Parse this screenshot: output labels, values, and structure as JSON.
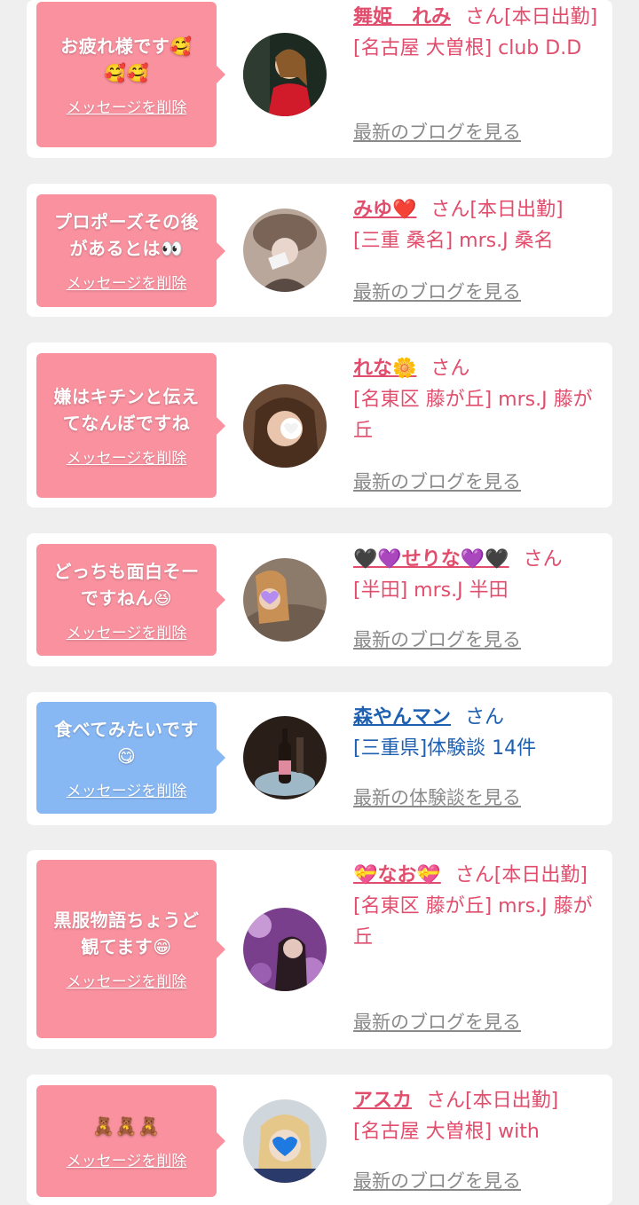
{
  "cards": [
    {
      "message_line1": "お疲れ様です🥰",
      "message_line2": "🥰🥰",
      "delete_label": "メッセージを削除",
      "name": "舞姫　れみ",
      "honorific": "さん[本日出勤]",
      "shop": "[名古屋 大曽根] club D.D",
      "link": "最新のブログを見る"
    },
    {
      "message_line1": "プロポーズその後",
      "message_line2": "があるとは👀",
      "delete_label": "メッセージを削除",
      "name": "みゆ❤️",
      "honorific": "さん[本日出勤]",
      "shop": "[三重 桑名] mrs.J 桑名",
      "link": "最新のブログを見る"
    },
    {
      "message_line1": "嫌はキチンと伝え",
      "message_line2": "てなんぼですね",
      "delete_label": "メッセージを削除",
      "name": "れな🌼",
      "honorific": "さん",
      "shop": "[名東区 藤が丘] mrs.J 藤が丘",
      "link": "最新のブログを見る"
    },
    {
      "message_line1": "どっちも面白そー",
      "message_line2": "ですねん😆",
      "delete_label": "メッセージを削除",
      "name": "🖤💜せりな💜🖤",
      "honorific": "さん",
      "shop": "[半田] mrs.J 半田",
      "link": "最新のブログを見る"
    },
    {
      "message_line1": "食べてみたいです",
      "message_line2": "😋",
      "delete_label": "メッセージを削除",
      "name": "森やんマン",
      "honorific": "さん",
      "shop": "[三重県]体験談 14件",
      "link": "最新の体験談を見る"
    },
    {
      "message_line1": "黒服物語ちょうど",
      "message_line2": "観てます😁",
      "delete_label": "メッセージを削除",
      "name": "💝なお💝",
      "honorific": "さん[本日出勤]",
      "shop": "[名東区 藤が丘] mrs.J 藤が丘",
      "link": "最新のブログを見る"
    },
    {
      "message_line1": "🧸🧸🧸",
      "message_line2": "",
      "delete_label": "メッセージを削除",
      "name": "アスカ",
      "honorific": "さん[本日出勤]",
      "shop": "[名古屋 大曽根] with",
      "link": "最新のブログを見る"
    }
  ],
  "colors": {
    "pink_bubble": "#f9919f",
    "blue_bubble": "#88b8f4",
    "pink_text": "#e14d6c",
    "blue_text": "#1d5fb0",
    "link_gray": "#8a8a8a",
    "background": "#efefef"
  },
  "avatars": [
    "avatar-red-dress-woman",
    "avatar-woman-fur-hat",
    "avatar-woman-heart-sticker",
    "avatar-woman-purple-heart-sticker",
    "avatar-champagne-bottle",
    "avatar-woman-purple-flowers",
    "avatar-woman-blue-heart-sticker"
  ]
}
